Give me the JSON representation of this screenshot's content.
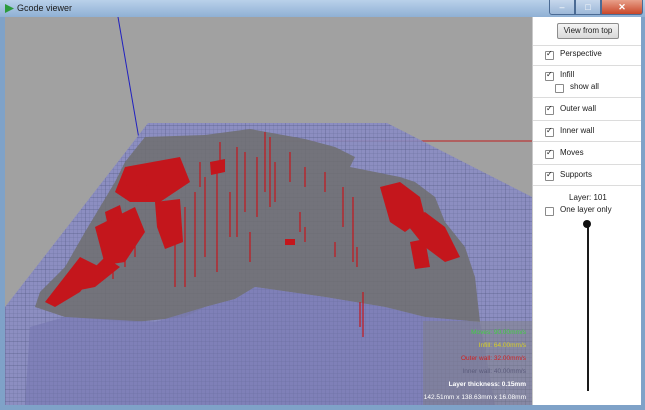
{
  "window": {
    "title": "Gcode viewer"
  },
  "panel": {
    "view_from_top": "View from top",
    "options": [
      {
        "label": "Perspective",
        "checked": true
      },
      {
        "label": "Infill",
        "checked": true
      },
      {
        "label": "show all",
        "checked": false
      },
      {
        "label": "Outer wall",
        "checked": true
      },
      {
        "label": "Inner wall",
        "checked": true
      },
      {
        "label": "Moves",
        "checked": true
      },
      {
        "label": "Supports",
        "checked": true
      }
    ],
    "layer_label": "Layer: 101",
    "one_layer_only": {
      "label": "One layer only",
      "checked": false
    },
    "slider_position": "top"
  },
  "stats": {
    "moves": "Moves: 90.00mm/s",
    "infill": "Infill: 64.00mm/s",
    "outer_wall": "Outer wall: 32.00mm/s",
    "inner_wall": "Inner wall: 40.00mm/s",
    "layer_thickness": "Layer thickness: 0.15mm",
    "dimensions": "142.51mm x 138.63mm x 16.08mm"
  },
  "colors": {
    "background": "#a1a1a1",
    "bed": "#8a8cc4",
    "model_top": "#6e6e6e",
    "walls": "#c4161c",
    "moves": "#40d040",
    "infill": "#d8d020",
    "outer_wall": "#d02020",
    "inner_wall": "#9090a0"
  }
}
